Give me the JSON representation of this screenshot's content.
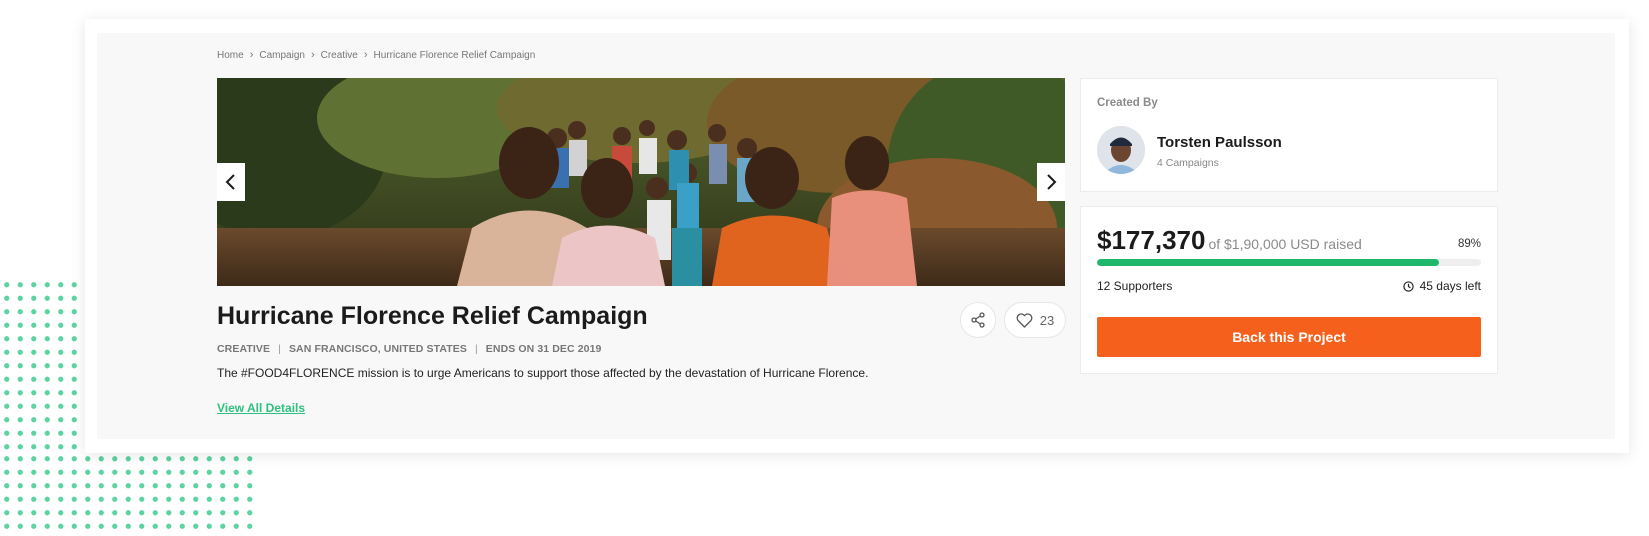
{
  "breadcrumb": {
    "items": [
      "Home",
      "Campaign",
      "Creative",
      "Hurricane Florence Relief Campaign"
    ]
  },
  "icons": {
    "chevron": "chevron-right-icon",
    "prev": "chevron-left-icon",
    "next": "chevron-right-icon",
    "share": "share-icon",
    "like": "heart-icon",
    "clock": "clock-icon"
  },
  "campaign": {
    "title": "Hurricane Florence Relief Campaign",
    "category": "CREATIVE",
    "location": "SAN FRANCISCO, UNITED STATES",
    "ends": "ENDS ON 31 DEC 2019",
    "description": "The #FOOD4FLORENCE mission is to urge Americans to support those affected by the devastation of Hurricane Florence.",
    "view_all_label": "View All Details",
    "likes": "23"
  },
  "creator": {
    "label": "Created By",
    "name": "Torsten Paulsson",
    "campaigns": "4 Campaigns"
  },
  "funding": {
    "raised": "$177,370",
    "goal_text": "of $1,90,000 USD raised",
    "percent_label": "89%",
    "progress_fraction": 0.89,
    "supporters": "12 Supporters",
    "days_left": "45 days left",
    "cta_label": "Back this Project"
  },
  "colors": {
    "accent_green": "#2ec27e",
    "progress_green": "#1fb86a",
    "cta_orange": "#f5601d",
    "dots_green": "#5cd3a0"
  }
}
